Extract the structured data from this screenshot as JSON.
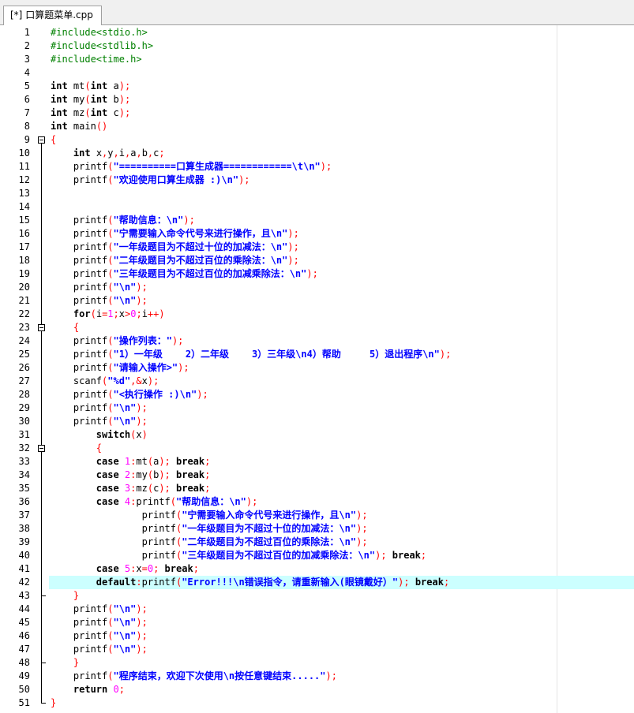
{
  "tab": {
    "modified_marker": "[*]",
    "filename": "口算题菜单.cpp"
  },
  "lines": [
    {
      "n": "1",
      "parts": [
        [
          "pp",
          "#include<stdio.h>"
        ]
      ]
    },
    {
      "n": "2",
      "parts": [
        [
          "pp",
          "#include<stdlib.h>"
        ]
      ]
    },
    {
      "n": "3",
      "parts": [
        [
          "pp",
          "#include<time.h>"
        ]
      ]
    },
    {
      "n": "4",
      "parts": []
    },
    {
      "n": "5",
      "parts": [
        [
          "kw",
          "int"
        ],
        [
          "",
          "mt"
        ],
        [
          "sym",
          "("
        ],
        [
          "kw",
          "int"
        ],
        [
          "",
          "a"
        ],
        [
          "sym",
          ")"
        ],
        [
          "sym",
          ";"
        ]
      ]
    },
    {
      "n": "6",
      "parts": [
        [
          "kw",
          "int"
        ],
        [
          "",
          "my"
        ],
        [
          "sym",
          "("
        ],
        [
          "kw",
          "int"
        ],
        [
          "",
          "b"
        ],
        [
          "sym",
          ")"
        ],
        [
          "sym",
          ";"
        ]
      ]
    },
    {
      "n": "7",
      "parts": [
        [
          "kw",
          "int"
        ],
        [
          "",
          "mz"
        ],
        [
          "sym",
          "("
        ],
        [
          "kw",
          "int"
        ],
        [
          "",
          "c"
        ],
        [
          "sym",
          ")"
        ],
        [
          "sym",
          ";"
        ]
      ]
    },
    {
      "n": "8",
      "parts": [
        [
          "kw",
          "int"
        ],
        [
          "",
          "main"
        ],
        [
          "sym",
          "()"
        ]
      ]
    },
    {
      "n": "9",
      "parts": [
        [
          "sym",
          "{"
        ]
      ]
    },
    {
      "n": "10",
      "parts": [
        [
          "",
          "    "
        ],
        [
          "kw",
          "int"
        ],
        [
          "",
          "x"
        ],
        [
          "sym",
          ","
        ],
        [
          "",
          "y"
        ],
        [
          "sym",
          ","
        ],
        [
          "",
          "i"
        ],
        [
          "sym",
          ","
        ],
        [
          "",
          "a"
        ],
        [
          "sym",
          ","
        ],
        [
          "",
          "b"
        ],
        [
          "sym",
          ","
        ],
        [
          "",
          "c"
        ],
        [
          "sym",
          ";"
        ]
      ]
    },
    {
      "n": "11",
      "parts": [
        [
          "",
          "    printf"
        ],
        [
          "sym",
          "("
        ],
        [
          "str",
          "\"==========口算生成器============\\t\\n\""
        ],
        [
          "sym",
          ")"
        ],
        [
          "sym",
          ";"
        ]
      ]
    },
    {
      "n": "12",
      "parts": [
        [
          "",
          "    printf"
        ],
        [
          "sym",
          "("
        ],
        [
          "str",
          "\"欢迎使用口算生成器 :)\\n\""
        ],
        [
          "sym",
          ")"
        ],
        [
          "sym",
          ";"
        ]
      ]
    },
    {
      "n": "13",
      "parts": []
    },
    {
      "n": "14",
      "parts": []
    },
    {
      "n": "15",
      "parts": [
        [
          "",
          "    printf"
        ],
        [
          "sym",
          "("
        ],
        [
          "str",
          "\"帮助信息：\\n\""
        ],
        [
          "sym",
          ")"
        ],
        [
          "sym",
          ";"
        ]
      ]
    },
    {
      "n": "16",
      "parts": [
        [
          "",
          "    printf"
        ],
        [
          "sym",
          "("
        ],
        [
          "str",
          "\"宁需要输入命令代号来进行操作，且\\n\""
        ],
        [
          "sym",
          ")"
        ],
        [
          "sym",
          ";"
        ]
      ]
    },
    {
      "n": "17",
      "parts": [
        [
          "",
          "    printf"
        ],
        [
          "sym",
          "("
        ],
        [
          "str",
          "\"一年级题目为不超过十位的加减法：\\n\""
        ],
        [
          "sym",
          ")"
        ],
        [
          "sym",
          ";"
        ]
      ]
    },
    {
      "n": "18",
      "parts": [
        [
          "",
          "    printf"
        ],
        [
          "sym",
          "("
        ],
        [
          "str",
          "\"二年级题目为不超过百位的乘除法：\\n\""
        ],
        [
          "sym",
          ")"
        ],
        [
          "sym",
          ";"
        ]
      ]
    },
    {
      "n": "19",
      "parts": [
        [
          "",
          "    printf"
        ],
        [
          "sym",
          "("
        ],
        [
          "str",
          "\"三年级题目为不超过百位的加减乘除法：\\n\""
        ],
        [
          "sym",
          ")"
        ],
        [
          "sym",
          ";"
        ]
      ]
    },
    {
      "n": "20",
      "parts": [
        [
          "",
          "    printf"
        ],
        [
          "sym",
          "("
        ],
        [
          "str",
          "\"\\n\""
        ],
        [
          "sym",
          ")"
        ],
        [
          "sym",
          ";"
        ]
      ]
    },
    {
      "n": "21",
      "parts": [
        [
          "",
          "    printf"
        ],
        [
          "sym",
          "("
        ],
        [
          "str",
          "\"\\n\""
        ],
        [
          "sym",
          ")"
        ],
        [
          "sym",
          ";"
        ]
      ]
    },
    {
      "n": "22",
      "parts": [
        [
          "",
          "    "
        ],
        [
          "kw",
          "for"
        ],
        [
          "sym",
          "("
        ],
        [
          "",
          "i"
        ],
        [
          "sym",
          "="
        ],
        [
          "num",
          "1"
        ],
        [
          "sym",
          ";"
        ],
        [
          "",
          "x"
        ],
        [
          "sym",
          ">"
        ],
        [
          "num",
          "0"
        ],
        [
          "sym",
          ";"
        ],
        [
          "",
          "i"
        ],
        [
          "sym",
          "++)"
        ]
      ]
    },
    {
      "n": "23",
      "parts": [
        [
          "",
          "    "
        ],
        [
          "sym",
          "{"
        ]
      ]
    },
    {
      "n": "24",
      "parts": [
        [
          "",
          "    printf"
        ],
        [
          "sym",
          "("
        ],
        [
          "str",
          "\"操作列表：\""
        ],
        [
          "sym",
          ")"
        ],
        [
          "sym",
          ";"
        ]
      ]
    },
    {
      "n": "25",
      "parts": [
        [
          "",
          "    printf"
        ],
        [
          "sym",
          "("
        ],
        [
          "str",
          "\"1）一年级    2）二年级    3）三年级\\n4）帮助     5）退出程序\\n\""
        ],
        [
          "sym",
          ")"
        ],
        [
          "sym",
          ";"
        ]
      ]
    },
    {
      "n": "26",
      "parts": [
        [
          "",
          "    printf"
        ],
        [
          "sym",
          "("
        ],
        [
          "str",
          "\"请输入操作>\""
        ],
        [
          "sym",
          ")"
        ],
        [
          "sym",
          ";"
        ]
      ]
    },
    {
      "n": "27",
      "parts": [
        [
          "",
          "    scanf"
        ],
        [
          "sym",
          "("
        ],
        [
          "str",
          "\"%d\""
        ],
        [
          "sym",
          ","
        ],
        [
          "sym",
          "&"
        ],
        [
          "",
          "x"
        ],
        [
          "sym",
          ")"
        ],
        [
          "sym",
          ";"
        ]
      ]
    },
    {
      "n": "28",
      "parts": [
        [
          "",
          "    printf"
        ],
        [
          "sym",
          "("
        ],
        [
          "str",
          "\"<执行操作 :)\\n\""
        ],
        [
          "sym",
          ")"
        ],
        [
          "sym",
          ";"
        ]
      ]
    },
    {
      "n": "29",
      "parts": [
        [
          "",
          "    printf"
        ],
        [
          "sym",
          "("
        ],
        [
          "str",
          "\"\\n\""
        ],
        [
          "sym",
          ")"
        ],
        [
          "sym",
          ";"
        ]
      ]
    },
    {
      "n": "30",
      "parts": [
        [
          "",
          "    printf"
        ],
        [
          "sym",
          "("
        ],
        [
          "str",
          "\"\\n\""
        ],
        [
          "sym",
          ")"
        ],
        [
          "sym",
          ";"
        ]
      ]
    },
    {
      "n": "31",
      "parts": [
        [
          "",
          "        "
        ],
        [
          "kw",
          "switch"
        ],
        [
          "sym",
          "("
        ],
        [
          "",
          "x"
        ],
        [
          "sym",
          ")"
        ]
      ]
    },
    {
      "n": "32",
      "parts": [
        [
          "",
          "        "
        ],
        [
          "sym",
          "{"
        ]
      ]
    },
    {
      "n": "33",
      "parts": [
        [
          "",
          "        "
        ],
        [
          "kw",
          "case"
        ],
        [
          "num",
          "1"
        ],
        [
          "sym",
          ":"
        ],
        [
          "",
          "mt"
        ],
        [
          "sym",
          "("
        ],
        [
          "",
          "a"
        ],
        [
          "sym",
          ")"
        ],
        [
          "sym",
          ";"
        ],
        [
          "kw",
          "break"
        ],
        [
          "sym",
          ";"
        ]
      ]
    },
    {
      "n": "34",
      "parts": [
        [
          "",
          "        "
        ],
        [
          "kw",
          "case"
        ],
        [
          "num",
          "2"
        ],
        [
          "sym",
          ":"
        ],
        [
          "",
          "my"
        ],
        [
          "sym",
          "("
        ],
        [
          "",
          "b"
        ],
        [
          "sym",
          ")"
        ],
        [
          "sym",
          ";"
        ],
        [
          "kw",
          "break"
        ],
        [
          "sym",
          ";"
        ]
      ]
    },
    {
      "n": "35",
      "parts": [
        [
          "",
          "        "
        ],
        [
          "kw",
          "case"
        ],
        [
          "num",
          "3"
        ],
        [
          "sym",
          ":"
        ],
        [
          "",
          "mz"
        ],
        [
          "sym",
          "("
        ],
        [
          "",
          "c"
        ],
        [
          "sym",
          ")"
        ],
        [
          "sym",
          ";"
        ],
        [
          "kw",
          "break"
        ],
        [
          "sym",
          ";"
        ]
      ]
    },
    {
      "n": "36",
      "parts": [
        [
          "",
          "        "
        ],
        [
          "kw",
          "case"
        ],
        [
          "num",
          "4"
        ],
        [
          "sym",
          ":"
        ],
        [
          "",
          "printf"
        ],
        [
          "sym",
          "("
        ],
        [
          "str",
          "\"帮助信息：\\n\""
        ],
        [
          "sym",
          ")"
        ],
        [
          "sym",
          ";"
        ]
      ]
    },
    {
      "n": "37",
      "parts": [
        [
          "",
          "                printf"
        ],
        [
          "sym",
          "("
        ],
        [
          "str",
          "\"宁需要输入命令代号来进行操作，且\\n\""
        ],
        [
          "sym",
          ")"
        ],
        [
          "sym",
          ";"
        ]
      ]
    },
    {
      "n": "38",
      "parts": [
        [
          "",
          "                printf"
        ],
        [
          "sym",
          "("
        ],
        [
          "str",
          "\"一年级题目为不超过十位的加减法：\\n\""
        ],
        [
          "sym",
          ")"
        ],
        [
          "sym",
          ";"
        ]
      ]
    },
    {
      "n": "39",
      "parts": [
        [
          "",
          "                printf"
        ],
        [
          "sym",
          "("
        ],
        [
          "str",
          "\"二年级题目为不超过百位的乘除法：\\n\""
        ],
        [
          "sym",
          ")"
        ],
        [
          "sym",
          ";"
        ]
      ]
    },
    {
      "n": "40",
      "parts": [
        [
          "",
          "                printf"
        ],
        [
          "sym",
          "("
        ],
        [
          "str",
          "\"三年级题目为不超过百位的加减乘除法：\\n\""
        ],
        [
          "sym",
          ")"
        ],
        [
          "sym",
          ";"
        ],
        [
          "kw",
          "break"
        ],
        [
          "sym",
          ";"
        ]
      ]
    },
    {
      "n": "41",
      "parts": [
        [
          "",
          "        "
        ],
        [
          "kw",
          "case"
        ],
        [
          "num",
          "5"
        ],
        [
          "sym",
          ":"
        ],
        [
          "",
          "x"
        ],
        [
          "sym",
          "="
        ],
        [
          "num",
          "0"
        ],
        [
          "sym",
          ";"
        ],
        [
          "kw",
          "break"
        ],
        [
          "sym",
          ";"
        ]
      ]
    },
    {
      "n": "42",
      "parts": [
        [
          "",
          "        "
        ],
        [
          "kw",
          "default"
        ],
        [
          "sym",
          ":"
        ],
        [
          "",
          "printf"
        ],
        [
          "sym",
          "("
        ],
        [
          "str",
          "\"Error!!!\\n错误指令，请重新输入(眼镜戴好）\""
        ],
        [
          "sym",
          ")"
        ],
        [
          "sym",
          ";"
        ],
        [
          "kw",
          "break"
        ],
        [
          "sym",
          ";"
        ]
      ]
    },
    {
      "n": "43",
      "parts": [
        [
          "",
          "    "
        ],
        [
          "sym",
          "}"
        ]
      ]
    },
    {
      "n": "44",
      "parts": [
        [
          "",
          "    printf"
        ],
        [
          "sym",
          "("
        ],
        [
          "str",
          "\"\\n\""
        ],
        [
          "sym",
          ")"
        ],
        [
          "sym",
          ";"
        ]
      ]
    },
    {
      "n": "45",
      "parts": [
        [
          "",
          "    printf"
        ],
        [
          "sym",
          "("
        ],
        [
          "str",
          "\"\\n\""
        ],
        [
          "sym",
          ")"
        ],
        [
          "sym",
          ";"
        ]
      ]
    },
    {
      "n": "46",
      "parts": [
        [
          "",
          "    printf"
        ],
        [
          "sym",
          "("
        ],
        [
          "str",
          "\"\\n\""
        ],
        [
          "sym",
          ")"
        ],
        [
          "sym",
          ";"
        ]
      ]
    },
    {
      "n": "47",
      "parts": [
        [
          "",
          "    printf"
        ],
        [
          "sym",
          "("
        ],
        [
          "str",
          "\"\\n\""
        ],
        [
          "sym",
          ")"
        ],
        [
          "sym",
          ";"
        ]
      ]
    },
    {
      "n": "48",
      "parts": [
        [
          "",
          "    "
        ],
        [
          "sym",
          "}"
        ]
      ]
    },
    {
      "n": "49",
      "parts": [
        [
          "",
          "    printf"
        ],
        [
          "sym",
          "("
        ],
        [
          "str",
          "\"程序结束，欢迎下次使用\\n按任意键结束.....\""
        ],
        [
          "sym",
          ")"
        ],
        [
          "sym",
          ";"
        ]
      ]
    },
    {
      "n": "50",
      "parts": [
        [
          "",
          "    "
        ],
        [
          "kw",
          "return"
        ],
        [
          "num",
          "0"
        ],
        [
          "sym",
          ";"
        ]
      ]
    },
    {
      "n": "51",
      "parts": [
        [
          "sym",
          "}"
        ]
      ]
    }
  ],
  "highlighted_line": "42",
  "fold_markers": [
    "9",
    "23",
    "32"
  ],
  "colors": {
    "preprocessor": "#008000",
    "keyword": "#000000",
    "string": "#0000ff",
    "number": "#ff00ff",
    "symbol": "#ff0000",
    "current_line": "#ccffff"
  }
}
